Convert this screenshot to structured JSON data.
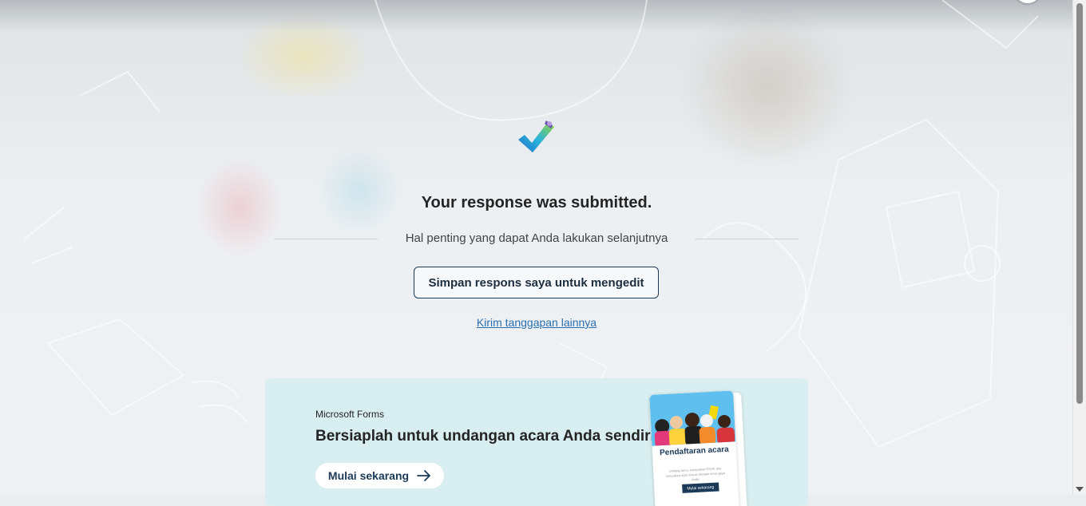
{
  "confirmation": {
    "title": "Your response was submitted.",
    "next_steps_label": "Hal penting yang dapat Anda lakukan selanjutnya",
    "save_button_label": "Simpan respons saya untuk mengedit",
    "another_response_link": "Kirim tanggapan lainnya"
  },
  "promo": {
    "brand": "Microsoft Forms",
    "title": "Bersiaplah untuk undangan acara Anda sendiri!",
    "start_button_label": "Mulai sekarang",
    "start_icon": "arrow-right-icon",
    "card": {
      "title": "Pendaftaran acara",
      "body": "Undang tamu, kumpulkan RSVP, dan sesuaikan agar sesuai dengan tema gaya Anda.",
      "button_label": "Mulai sekarang"
    }
  },
  "colors": {
    "primary_dark": "#1b3a57",
    "link": "#2a6fb0",
    "promo_background": "#d9eef0"
  }
}
